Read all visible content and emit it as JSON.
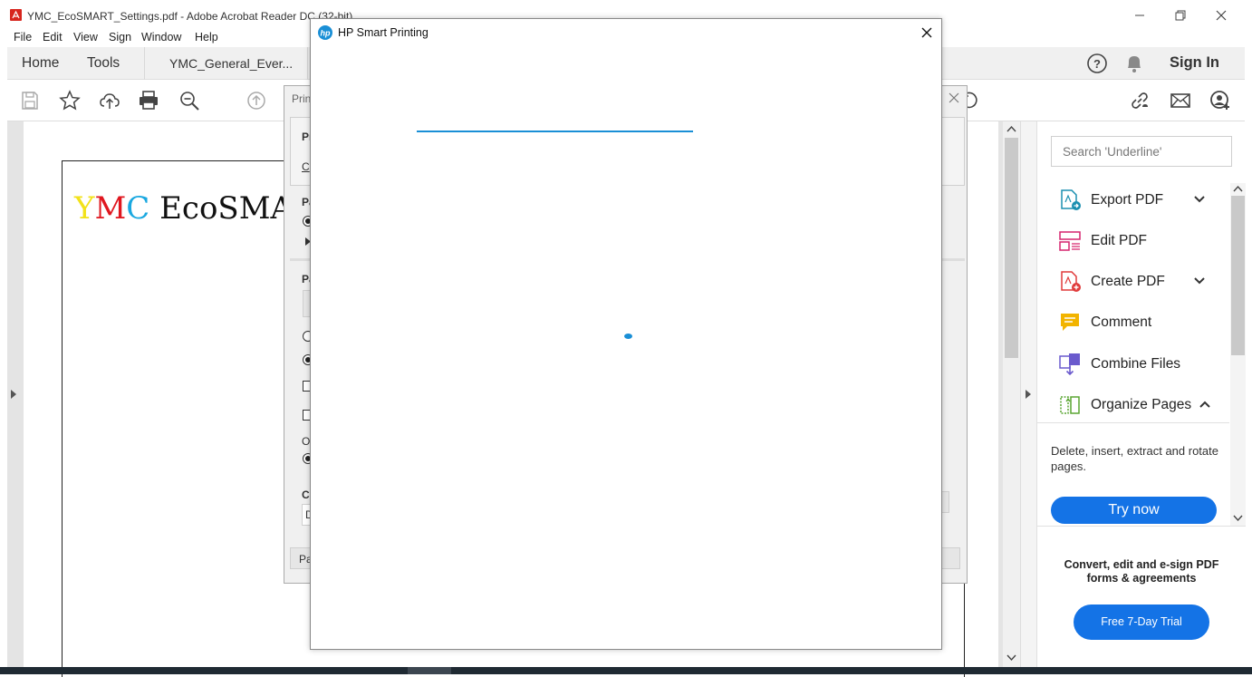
{
  "window": {
    "title": "YMC_EcoSMART_Settings.pdf - Adobe Acrobat Reader DC (32-bit)",
    "controls": {
      "minimize": "–",
      "restore": "❐",
      "close": "✕"
    }
  },
  "menu": [
    "File",
    "Edit",
    "View",
    "Sign",
    "Window",
    "Help"
  ],
  "nav": {
    "home": "Home",
    "tools": "Tools",
    "doc_tab": "YMC_General_Ever...",
    "sign_in": "Sign In"
  },
  "toolbar": {
    "icons": [
      "save-icon",
      "star-icon",
      "upload-cloud-icon",
      "print-icon",
      "zoom-out-icon",
      "page-up-icon"
    ],
    "right_icons": [
      "link-icon",
      "mail-icon",
      "add-user-icon"
    ]
  },
  "document": {
    "title_y": "Y",
    "title_m": "M",
    "title_c": "C",
    "title_rest": " EcoSMAR",
    "colors": {
      "y": "#f2e21a",
      "m": "#e0171f",
      "c": "#1aa8e0"
    }
  },
  "right_pane": {
    "search_placeholder": "Search 'Underline'",
    "tools": [
      {
        "label": "Export PDF",
        "icon": "export-pdf-icon",
        "color": "#1b8fb0",
        "has_chevron": true
      },
      {
        "label": "Edit PDF",
        "icon": "edit-pdf-icon",
        "color": "#d6246e",
        "has_chevron": false
      },
      {
        "label": "Create PDF",
        "icon": "create-pdf-icon",
        "color": "#e03a3a",
        "has_chevron": true
      },
      {
        "label": "Comment",
        "icon": "comment-icon",
        "color": "#f2b400",
        "has_chevron": false
      },
      {
        "label": "Combine Files",
        "icon": "combine-files-icon",
        "color": "#6a5acd",
        "has_chevron": false
      },
      {
        "label": "Organize Pages",
        "icon": "organize-pages-icon",
        "color": "#5aa532",
        "has_chevron": true
      }
    ],
    "description": "Delete, insert, extract and rotate pages.",
    "try_now": "Try now",
    "promo": "Convert, edit and e-sign PDF forms & agreements",
    "trial_button": "Free 7-Day Trial"
  },
  "print_dialog": {
    "title": "Prin",
    "fragments": [
      "Pr",
      "C",
      "Pa",
      "Pa",
      "O",
      "Co",
      "D",
      "Pa"
    ]
  },
  "hp_window": {
    "title": "HP Smart Printing",
    "accent": "#1a8fd6"
  }
}
